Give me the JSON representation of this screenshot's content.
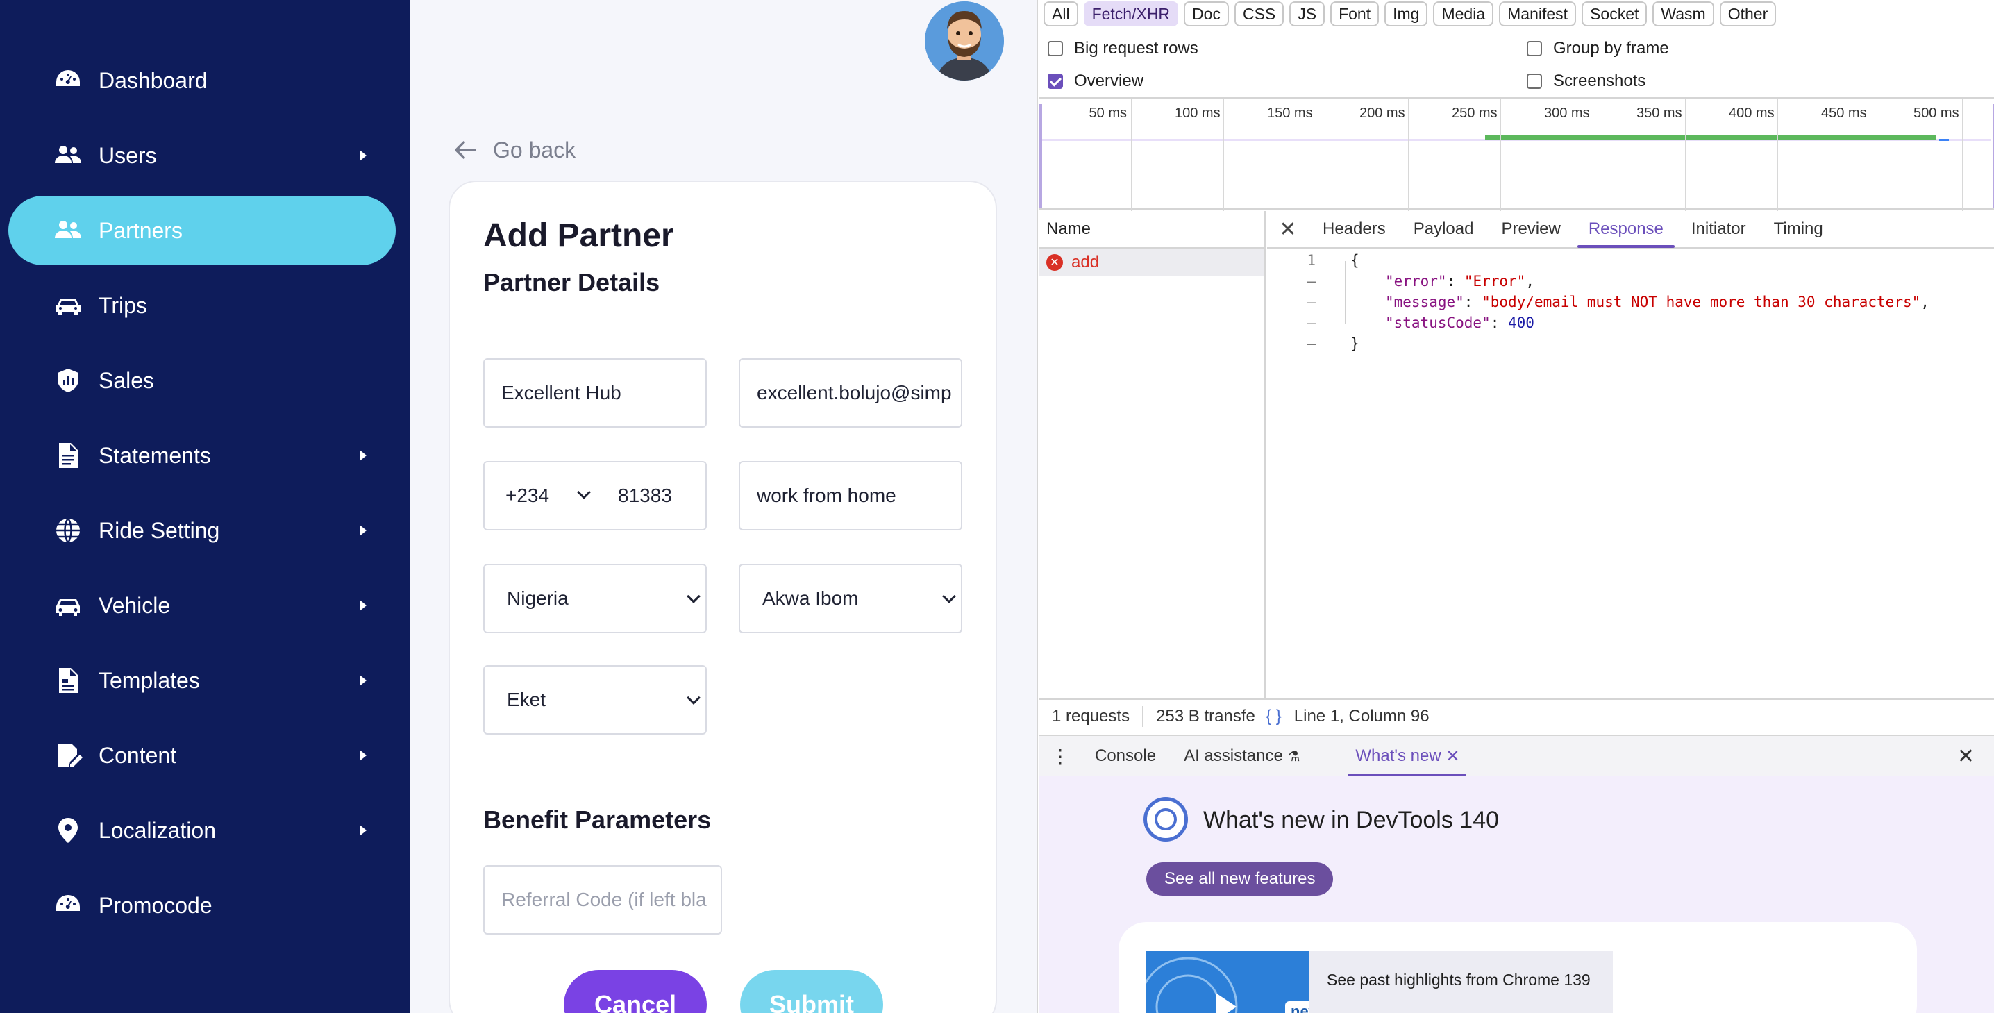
{
  "sidebar": {
    "items": [
      {
        "label": "Dashboard",
        "icon": "dashboard-icon",
        "has_submenu": false,
        "active": false
      },
      {
        "label": "Users",
        "icon": "users-icon",
        "has_submenu": true,
        "active": false
      },
      {
        "label": "Partners",
        "icon": "partners-icon",
        "has_submenu": false,
        "active": true
      },
      {
        "label": "Trips",
        "icon": "car-icon",
        "has_submenu": false,
        "active": false
      },
      {
        "label": "Sales",
        "icon": "sales-icon",
        "has_submenu": false,
        "active": false
      },
      {
        "label": "Statements",
        "icon": "document-icon",
        "has_submenu": true,
        "active": false
      },
      {
        "label": "Ride Setting",
        "icon": "globe-icon",
        "has_submenu": true,
        "active": false
      },
      {
        "label": "Vehicle",
        "icon": "vehicle-icon",
        "has_submenu": true,
        "active": false
      },
      {
        "label": "Templates",
        "icon": "template-icon",
        "has_submenu": true,
        "active": false
      },
      {
        "label": "Content",
        "icon": "content-icon",
        "has_submenu": true,
        "active": false
      },
      {
        "label": "Localization",
        "icon": "location-pin-icon",
        "has_submenu": true,
        "active": false
      },
      {
        "label": "Promocode",
        "icon": "promocode-icon",
        "has_submenu": false,
        "active": false
      }
    ],
    "colors": {
      "background": "#0e1c5b",
      "active": "#5fd1ec"
    }
  },
  "main": {
    "go_back": "Go back",
    "title": "Add Partner",
    "subtitle": "Partner Details",
    "fields": {
      "name": "Excellent Hub",
      "email": "excellent.bolujo@simp",
      "phone_code": "+234",
      "phone_number": "81383",
      "address": "work from home",
      "country": "Nigeria",
      "state": "Akwa Ibom",
      "city": "Eket"
    },
    "benefit_title": "Benefit Parameters",
    "referral_placeholder": "Referral Code (if left bla",
    "cancel_label": "Cancel",
    "submit_label": "Submit",
    "colors": {
      "cancel": "#7a42e4",
      "submit": "#78d6ee"
    }
  },
  "devtools": {
    "filters": [
      "All",
      "Fetch/XHR",
      "Doc",
      "CSS",
      "JS",
      "Font",
      "Img",
      "Media",
      "Manifest",
      "Socket",
      "Wasm",
      "Other"
    ],
    "active_filter": "Fetch/XHR",
    "checkboxes": {
      "big_request_rows": {
        "label": "Big request rows",
        "checked": false
      },
      "group_by_frame": {
        "label": "Group by frame",
        "checked": false
      },
      "overview": {
        "label": "Overview",
        "checked": true
      },
      "screenshots": {
        "label": "Screenshots",
        "checked": false
      }
    },
    "timeline_ticks": [
      "50 ms",
      "100 ms",
      "150 ms",
      "200 ms",
      "250 ms",
      "300 ms",
      "350 ms",
      "400 ms",
      "450 ms",
      "500 ms"
    ],
    "name_header": "Name",
    "request_name": "add",
    "tabs": [
      "Headers",
      "Payload",
      "Preview",
      "Response",
      "Initiator",
      "Timing"
    ],
    "active_tab": "Response",
    "response_lines": {
      "ln1": "1",
      "ln_dash": "–",
      "open": "{",
      "error_key": "\"error\"",
      "error_val": "\"Error\"",
      "message_key": "\"message\"",
      "message_val": "\"body/email must NOT have more than 30 characters\"",
      "status_key": "\"statusCode\"",
      "status_val": "400",
      "close": "}"
    },
    "status_bar": {
      "requests": "1 requests",
      "transferred": "253 B transfe",
      "format_icon": "{ }",
      "position": "Line 1, Column 96"
    },
    "drawer_tabs": [
      "Console",
      "AI assistance",
      "What's new"
    ],
    "active_drawer_tab": "What's new",
    "whats_new": {
      "title": "What's new in DevTools 140",
      "button": "See all new features",
      "badge": "new",
      "highlight_text": "See past highlights from Chrome 139"
    }
  }
}
